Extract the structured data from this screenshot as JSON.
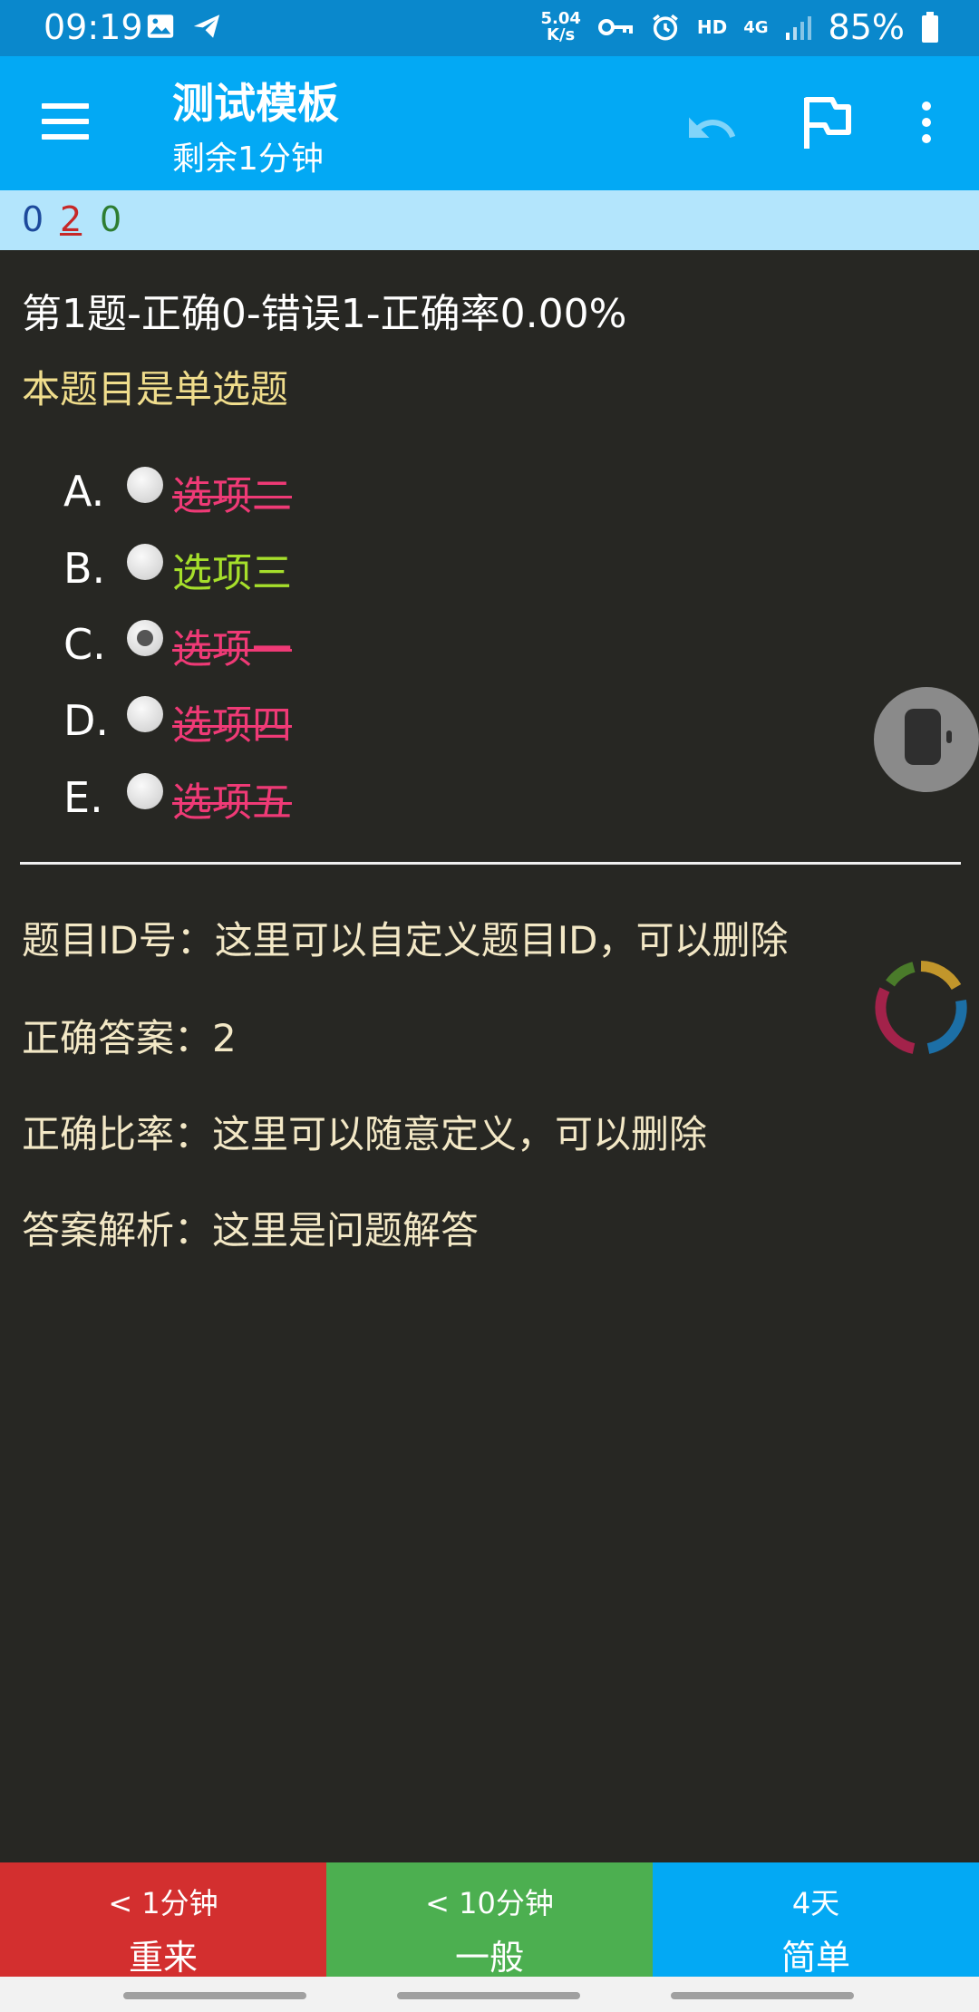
{
  "status_bar": {
    "time": "09:19",
    "net_speed_value": "5.04",
    "net_speed_unit": "K/s",
    "hd": "HD",
    "net_type": "4G",
    "battery": "85%",
    "icons": [
      "image-icon",
      "send-icon",
      "vpn-key-icon",
      "alarm-icon",
      "signal-icon",
      "battery-icon"
    ]
  },
  "app_bar": {
    "title": "测试模板",
    "subtitle": "剩余1分钟",
    "icons": [
      "menu-icon",
      "undo-icon",
      "flag-icon",
      "more-vert-icon"
    ]
  },
  "score": {
    "blue": "0",
    "red": "2",
    "green": "0"
  },
  "question": {
    "header": "第1题-正确0-错误1-正确率0.00%",
    "type": "本题目是单选题",
    "options": [
      {
        "letter": "A.",
        "text": "选项二",
        "state": "wrong",
        "checked": false
      },
      {
        "letter": "B.",
        "text": "选项三",
        "state": "correct",
        "checked": false
      },
      {
        "letter": "C.",
        "text": "选项一",
        "state": "wrong",
        "checked": true
      },
      {
        "letter": "D.",
        "text": "选项四",
        "state": "wrong",
        "checked": false
      },
      {
        "letter": "E.",
        "text": "选项五",
        "state": "wrong",
        "checked": false
      }
    ]
  },
  "details": {
    "id": "题目ID号：这里可以自定义题目ID，可以删除",
    "answer": "正确答案：2",
    "rate": "正确比率：这里可以随意定义，可以删除",
    "analysis": "答案解析：这里是问题解答"
  },
  "bottom_buttons": [
    {
      "time": "< 1分钟",
      "label": "重来",
      "color": "#d32f2f"
    },
    {
      "time": "< 10分钟",
      "label": "一般",
      "color": "#4caf50"
    },
    {
      "time": "4天",
      "label": "简单",
      "color": "#03a9f4"
    }
  ],
  "colors": {
    "status_bar": "#0a88cc",
    "app_bar": "#03a9f4",
    "score_bar": "#b3e5fc",
    "background": "#272723",
    "wrong_option": "#ef3a76",
    "correct_option": "#a6df2b",
    "question_type": "#f0dd8c"
  }
}
